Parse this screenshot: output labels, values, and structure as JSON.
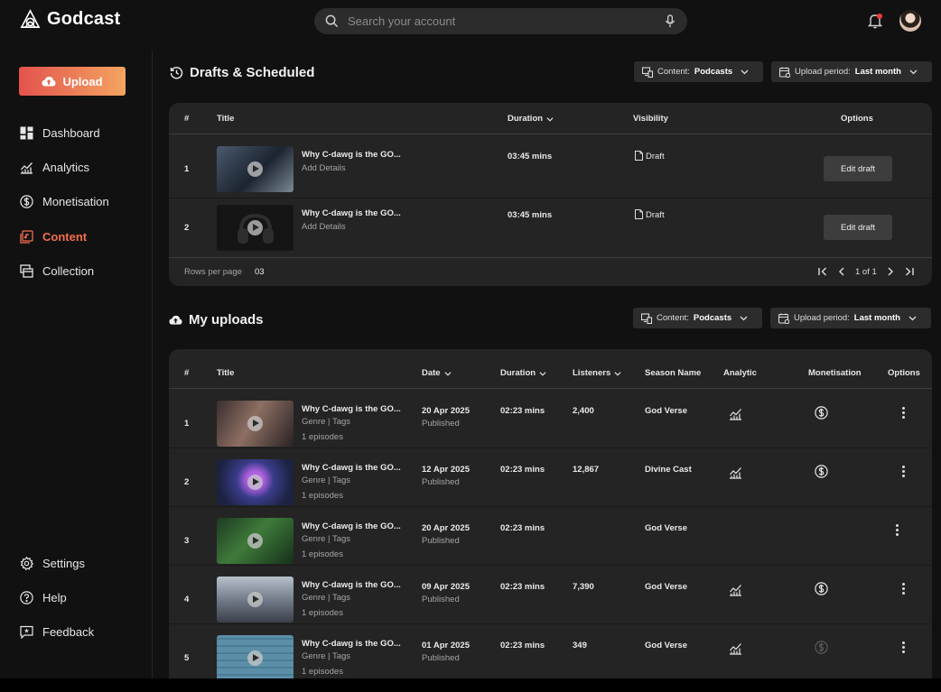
{
  "app": {
    "name": "Godcast"
  },
  "search": {
    "placeholder": "Search your account"
  },
  "sidebar": {
    "upload_label": "Upload",
    "nav": [
      {
        "label": "Dashboard",
        "icon": "dashboard-icon"
      },
      {
        "label": "Analytics",
        "icon": "analytics-icon"
      },
      {
        "label": "Monetisation",
        "icon": "dollar-icon"
      },
      {
        "label": "Content",
        "icon": "content-icon",
        "active": true
      },
      {
        "label": "Collection",
        "icon": "collection-icon"
      }
    ],
    "bottom": [
      {
        "label": "Settings",
        "icon": "gear-icon"
      },
      {
        "label": "Help",
        "icon": "help-icon"
      },
      {
        "label": "Feedback",
        "icon": "feedback-icon"
      }
    ]
  },
  "drafts": {
    "title": "Drafts & Scheduled",
    "content_filter": {
      "label": "Content:",
      "value": "Podcasts"
    },
    "period_filter": {
      "label": "Upload period:",
      "value": "Last month"
    },
    "columns": [
      "#",
      "Title",
      "Duration",
      "Visibility",
      "Options"
    ],
    "rows": [
      {
        "num": "1",
        "title": "Why C-dawg is the GO...",
        "subtitle": "Add Details",
        "duration": "03:45 mins",
        "visibility": "Draft",
        "action": "Edit draft"
      },
      {
        "num": "2",
        "title": "Why C-dawg is the GO...",
        "subtitle": "Add Details",
        "duration": "03:45 mins",
        "visibility": "Draft",
        "action": "Edit draft"
      }
    ],
    "rows_per_page_label": "Rows per page",
    "rows_per_page_value": "03",
    "page_info": "1 of 1"
  },
  "uploads": {
    "title": "My uploads",
    "content_filter": {
      "label": "Content:",
      "value": "Podcasts"
    },
    "period_filter": {
      "label": "Upload period:",
      "value": "Last month"
    },
    "columns": [
      "#",
      "Title",
      "Date",
      "Duration",
      "Listeners",
      "Season Name",
      "Analytic",
      "Monetisation",
      "Options"
    ],
    "rows": [
      {
        "num": "1",
        "title": "Why C-dawg is the GO...",
        "meta": "Genre | Tags",
        "episodes": "1 episodes",
        "date": "20 Apr 2025",
        "status": "Published",
        "duration": "02:23 mins",
        "listeners": "2,400",
        "season": "God Verse",
        "has_analytic": true,
        "monetised": true
      },
      {
        "num": "2",
        "title": "Why C-dawg is the GO...",
        "meta": "Genre | Tags",
        "episodes": "1 episodes",
        "date": "12 Apr 2025",
        "status": "Published",
        "duration": "02:23 mins",
        "listeners": "12,867",
        "season": "Divine Cast",
        "has_analytic": true,
        "monetised": true
      },
      {
        "num": "3",
        "title": "Why C-dawg is the GO...",
        "meta": "Genre | Tags",
        "episodes": "1 episodes",
        "date": "20 Apr 2025",
        "status": "Published",
        "duration": "02:23 mins",
        "listeners": "",
        "season": "God Verse",
        "has_analytic": false,
        "monetised": false
      },
      {
        "num": "4",
        "title": "Why C-dawg is the GO...",
        "meta": "Genre | Tags",
        "episodes": "1 episodes",
        "date": "09 Apr 2025",
        "status": "Published",
        "duration": "02:23 mins",
        "listeners": "7,390",
        "season": "God Verse",
        "has_analytic": true,
        "monetised": true
      },
      {
        "num": "5",
        "title": "Why C-dawg is the GO...",
        "meta": "Genre | Tags",
        "episodes": "1 episodes",
        "date": "01 Apr 2025",
        "status": "Published",
        "duration": "02:23 mins",
        "listeners": "349",
        "season": "God Verse",
        "has_analytic": true,
        "monetised": "dimmed"
      }
    ]
  },
  "colors": {
    "accent": "#f36f50",
    "upload_gradient_start": "#e3534e",
    "upload_gradient_end": "#f4a460",
    "notification": "#ef3b35"
  }
}
